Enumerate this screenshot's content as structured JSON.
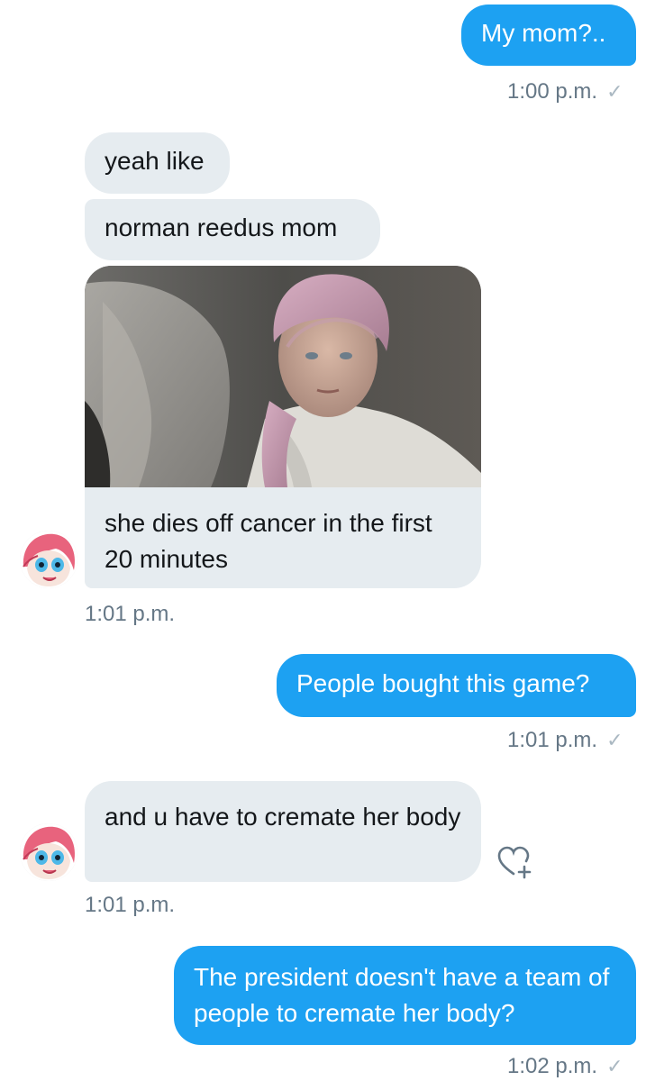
{
  "conversation": {
    "messages": [
      {
        "direction": "out",
        "text": "My mom?..",
        "time": "1:00 p.m.",
        "read_mark": "✓"
      },
      {
        "direction": "in",
        "text": "yeah like"
      },
      {
        "direction": "in",
        "text": "norman reedus mom"
      },
      {
        "direction": "in",
        "type": "image"
      },
      {
        "direction": "in",
        "text": "she dies off cancer in the first 20 minutes",
        "time": "1:01 p.m."
      },
      {
        "direction": "out",
        "text": "People bought this game?",
        "time": "1:01 p.m.",
        "read_mark": "✓"
      },
      {
        "direction": "in",
        "text": "and u have to cremate her body",
        "time": "1:01 p.m."
      },
      {
        "direction": "out",
        "text": "The president doesn't have a team of people to cremate her body?",
        "time": "1:02 p.m.",
        "read_mark": "✓"
      }
    ]
  },
  "icons": {
    "read_mark": "check-icon",
    "react": "heart-plus-icon",
    "avatar": "user-avatar"
  },
  "colors": {
    "outgoing_bubble": "#1da1f2",
    "incoming_bubble": "#e6ecf0",
    "timestamp": "#657786",
    "check": "#aab8c2"
  }
}
